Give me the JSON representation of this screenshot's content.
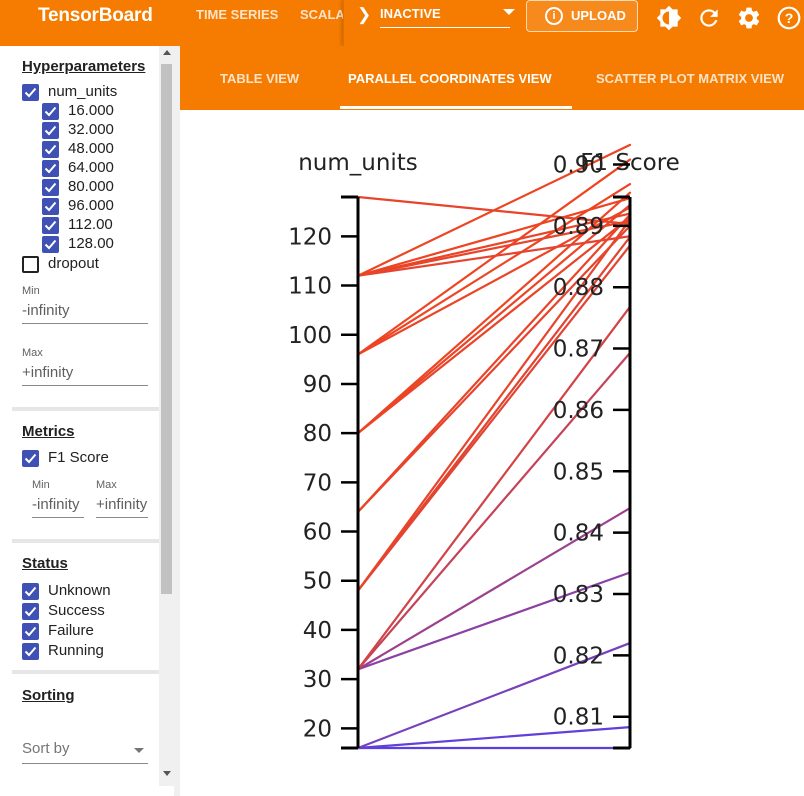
{
  "header": {
    "title": "TensorBoard",
    "nav_tabs": [
      "TIME SERIES",
      "SCALA"
    ],
    "plugin_select_value": "INACTIVE",
    "upload_label": "UPLOAD",
    "icons": [
      "theme-toggle-icon",
      "refresh-icon",
      "settings-icon",
      "help-icon"
    ],
    "accent_color": "#f57c00"
  },
  "sidebar": {
    "hyperparameters": {
      "title": "Hyperparameters",
      "num_units_label": "num_units",
      "num_units_values": [
        "16.000",
        "32.000",
        "48.000",
        "64.000",
        "80.000",
        "96.000",
        "112.00",
        "128.00"
      ],
      "dropout_label": "dropout",
      "min_label": "Min",
      "min_value": "-infinity",
      "max_label": "Max",
      "max_value": "+infinity"
    },
    "metrics": {
      "title": "Metrics",
      "f1_label": "F1 Score",
      "min_label": "Min",
      "min_value": "-infinity",
      "max_label": "Max",
      "max_value": "+infinity"
    },
    "status": {
      "title": "Status",
      "items": [
        "Unknown",
        "Success",
        "Failure",
        "Running"
      ]
    },
    "sorting": {
      "title": "Sorting",
      "sort_by_placeholder": "Sort by"
    }
  },
  "view_tabs": [
    "TABLE VIEW",
    "PARALLEL COORDINATES VIEW",
    "SCATTER PLOT MATRIX VIEW"
  ],
  "active_view_tab": "PARALLEL COORDINATES VIEW",
  "chart_data": {
    "type": "parallel-coordinates",
    "axes": [
      {
        "name": "num_units",
        "range": [
          16,
          128
        ],
        "ticks": [
          "20",
          "30",
          "40",
          "50",
          "60",
          "70",
          "80",
          "90",
          "100",
          "110",
          "120"
        ]
      },
      {
        "name": "F1 Score",
        "range": [
          0.8049,
          0.8947
        ],
        "ticks": [
          "0.81",
          "0.82",
          "0.83",
          "0.84",
          "0.85",
          "0.86",
          "0.87",
          "0.88",
          "0.89",
          "0.90"
        ]
      }
    ],
    "color_scale": {
      "low": "#5c3fe0",
      "high": "#ee4422"
    },
    "runs": [
      {
        "num_units": 16,
        "f1": 0.8049
      },
      {
        "num_units": 16,
        "f1": 0.8083
      },
      {
        "num_units": 16,
        "f1": 0.822
      },
      {
        "num_units": 32,
        "f1": 0.8335
      },
      {
        "num_units": 32,
        "f1": 0.844
      },
      {
        "num_units": 32,
        "f1": 0.8693
      },
      {
        "num_units": 32,
        "f1": 0.8768
      },
      {
        "num_units": 48,
        "f1": 0.8868
      },
      {
        "num_units": 48,
        "f1": 0.8882
      },
      {
        "num_units": 48,
        "f1": 0.891
      },
      {
        "num_units": 64,
        "f1": 0.89
      },
      {
        "num_units": 64,
        "f1": 0.8918
      },
      {
        "num_units": 80,
        "f1": 0.8914
      },
      {
        "num_units": 80,
        "f1": 0.8934
      },
      {
        "num_units": 80,
        "f1": 0.8954
      },
      {
        "num_units": 96,
        "f1": 0.893
      },
      {
        "num_units": 96,
        "f1": 0.8968
      },
      {
        "num_units": 96,
        "f1": 0.9008
      },
      {
        "num_units": 112,
        "f1": 0.8945
      },
      {
        "num_units": 112,
        "f1": 0.8908
      },
      {
        "num_units": 112,
        "f1": 0.8883
      },
      {
        "num_units": 112,
        "f1": 0.892
      },
      {
        "num_units": 112,
        "f1": 0.9032
      },
      {
        "num_units": 128,
        "f1": 0.8903
      }
    ]
  }
}
